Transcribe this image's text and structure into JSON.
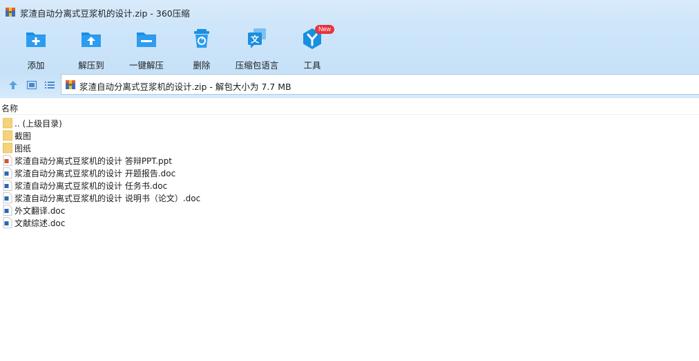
{
  "window": {
    "title": "浆渣自动分离式豆浆机的设计.zip - 360压缩"
  },
  "toolbar": {
    "items": [
      {
        "label": "添加",
        "icon": "add-folder-icon"
      },
      {
        "label": "解压到",
        "icon": "extract-to-icon"
      },
      {
        "label": "一键解压",
        "icon": "one-click-extract-icon"
      },
      {
        "label": "删除",
        "icon": "trash-icon"
      },
      {
        "label": "压缩包语言",
        "icon": "language-icon"
      },
      {
        "label": "工具",
        "icon": "tools-icon",
        "badge": "New"
      }
    ]
  },
  "addressbar": {
    "path": "浆渣自动分离式豆浆机的设计.zip - 解包大小为 7.7 MB"
  },
  "list": {
    "column_name": "名称",
    "items": [
      {
        "name": ".. (上级目录)",
        "type": "folder"
      },
      {
        "name": "截图",
        "type": "folder"
      },
      {
        "name": "图纸",
        "type": "folder"
      },
      {
        "name": "浆渣自动分离式豆浆机的设计 答辩PPT.ppt",
        "type": "ppt"
      },
      {
        "name": "浆渣自动分离式豆浆机的设计 开题报告.doc",
        "type": "doc"
      },
      {
        "name": "浆渣自动分离式豆浆机的设计 任务书.doc",
        "type": "doc"
      },
      {
        "name": "浆渣自动分离式豆浆机的设计 说明书（论文）.doc",
        "type": "doc"
      },
      {
        "name": "外文翻译.doc",
        "type": "doc"
      },
      {
        "name": "文献综述.doc",
        "type": "doc"
      }
    ]
  },
  "colors": {
    "accent": "#1a8fe0",
    "toolbar_bg": "#cfe6fa",
    "folder": "#f5d37a",
    "badge": "#e8343d"
  }
}
